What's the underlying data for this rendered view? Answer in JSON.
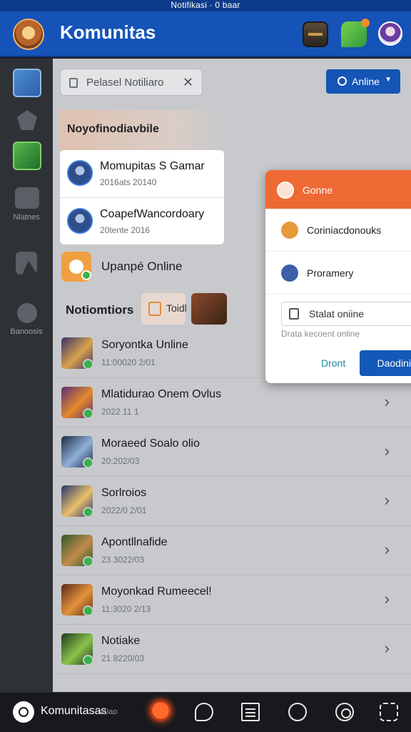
{
  "statusbar": {
    "text": "Notifikasi · 0 baar"
  },
  "appbar": {
    "title": "Komunitas",
    "icons": [
      "app-logo-icon",
      "treasure-chest-icon",
      "leaf-icon",
      "profile-avatar-icon"
    ]
  },
  "rail": {
    "items": [
      {
        "icon": "warrior-avatar-icon"
      },
      {
        "icon": "gem-icon"
      },
      {
        "icon": "dragon-avatar-icon"
      },
      {
        "icon": "controller-icon",
        "label": "Nlatnes"
      },
      {
        "icon": "chart-icon"
      },
      {
        "icon": "gear-icon",
        "label": "Banoosis"
      }
    ]
  },
  "search": {
    "placeholder": "Pelasel Notiliaro"
  },
  "online_button": {
    "label": "Anline"
  },
  "featured": {
    "title": "Noyofinodiavbile",
    "items": [
      {
        "title": "Momupitas S Gamar",
        "subtitle": "2016ats 20140"
      },
      {
        "title": "CoapefWancordoary",
        "subtitle": "20tente 2016"
      }
    ]
  },
  "update": {
    "label": "Upanpé Online"
  },
  "notifications": {
    "title": "Notiomtiors",
    "chip_label": "Toidl",
    "items": [
      {
        "title": "Soryontka Unline",
        "subtitle": "11:00020 2/01",
        "colors": [
          "#3a2f6e",
          "#d9a24b"
        ]
      },
      {
        "title": "Mlatidurao Onem Ovlus",
        "subtitle": "2022 11 1",
        "colors": [
          "#5a2c7a",
          "#e58a2b"
        ]
      },
      {
        "title": "Moraeed Soalo olio",
        "subtitle": "20:202/03",
        "colors": [
          "#1f2a44",
          "#8fb0d8"
        ]
      },
      {
        "title": "Sorlroios",
        "subtitle": "2022/0 2/01",
        "colors": [
          "#24356e",
          "#e9c06a"
        ]
      },
      {
        "title": "Apontllnafide",
        "subtitle": "23 3022/03",
        "colors": [
          "#2e5a2e",
          "#c28a4a"
        ]
      },
      {
        "title": "Moyonkad Rumeecel!",
        "subtitle": "11:3020 2/13",
        "colors": [
          "#5a2a1a",
          "#e3933a"
        ]
      },
      {
        "title": "Notiake",
        "subtitle": "21 8220/03",
        "colors": [
          "#1e3a1e",
          "#8ac24a"
        ]
      }
    ]
  },
  "popup": {
    "title": "Gonne",
    "rows": [
      {
        "label": "Coriniacdonouks",
        "icon": "fox-avatar-icon",
        "color": "#e79a3a"
      },
      {
        "label": "Proramery",
        "icon": "knight-avatar-icon",
        "color": "#3d5fa8"
      }
    ],
    "field_value": "Stalat oniine",
    "hint": "Drata kecoent online",
    "cancel_label": "Dront",
    "confirm_label": "Daodinitions"
  },
  "bottombar": {
    "title": "Komunitasas",
    "subtitle": "a0ao",
    "icons": [
      "fire-icon",
      "chat-icon",
      "news-icon",
      "check-circle-icon",
      "swirl-icon",
      "scan-icon"
    ]
  }
}
